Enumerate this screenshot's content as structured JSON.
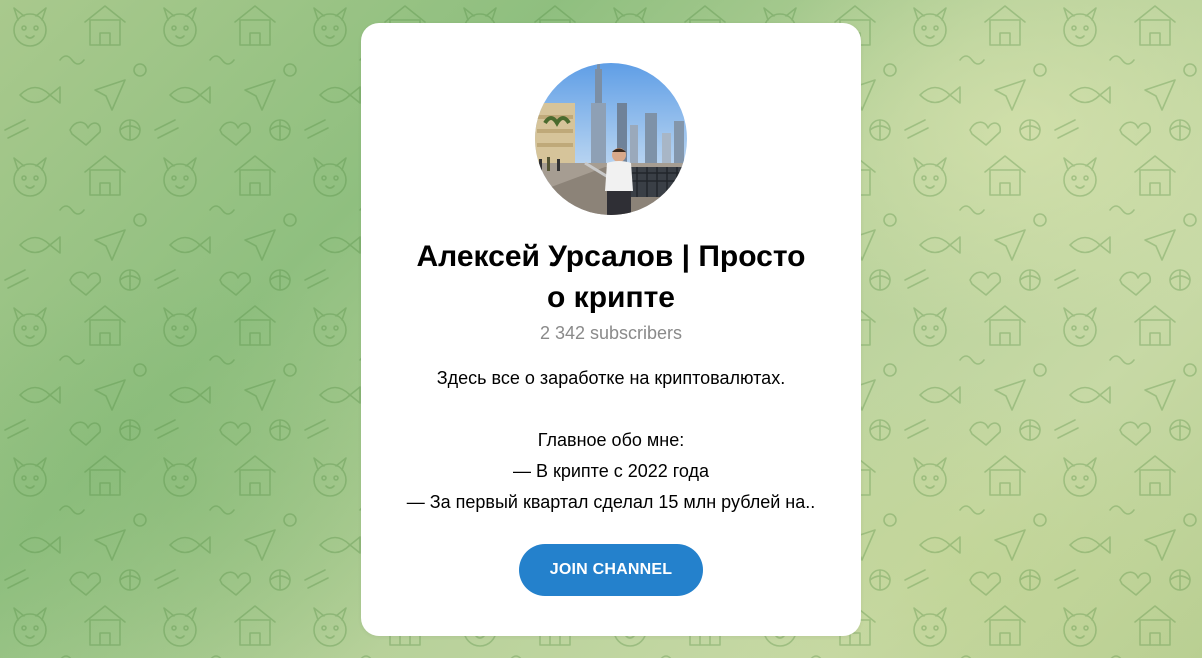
{
  "channel": {
    "title_line1": "Алексей Урсалов | Просто",
    "title_line2": "о крипте",
    "subscribers": "2 342 subscribers",
    "description": [
      "Здесь все о заработке на криптовалютах.",
      "",
      "Главное обо мне:",
      "— В крипте с 2022 года",
      "— За первый квартал сделал 15 млн рублей на.."
    ],
    "join_label": "JOIN CHANNEL"
  },
  "colors": {
    "accent": "#2481cc",
    "card": "#ffffff",
    "subscribers_text": "#8a8a8a"
  }
}
